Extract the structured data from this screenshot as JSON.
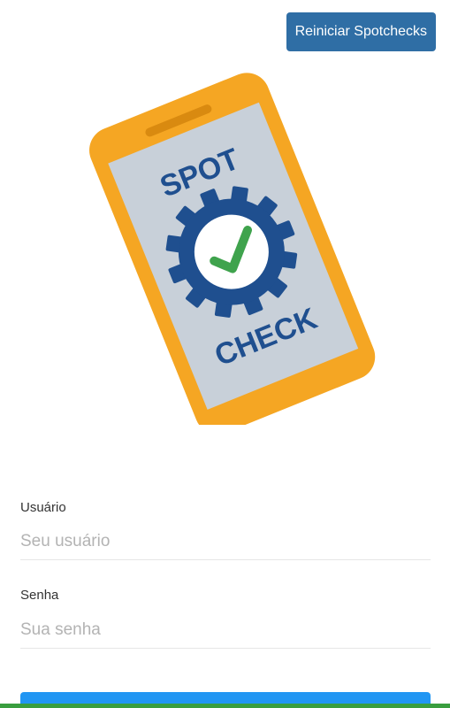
{
  "header": {
    "reset_label": "Reiniciar Spotchecks"
  },
  "logo": {
    "text_top": "SPOT",
    "text_bottom": "CHECK"
  },
  "form": {
    "user_label": "Usuário",
    "user_placeholder": "Seu usuário",
    "password_label": "Senha",
    "password_placeholder": "Sua senha"
  },
  "colors": {
    "primary": "#2f6ea5",
    "phone_body": "#f5a623",
    "screen_bg": "#c8d0d9",
    "gear": "#1f4f8f",
    "check": "#3fa34d",
    "login_button": "#2196f3",
    "bottom_strip": "#3a9e3f"
  },
  "icons": {
    "logo": "spotcheck-phone-logo",
    "gear": "gear-icon",
    "check": "check-icon"
  }
}
